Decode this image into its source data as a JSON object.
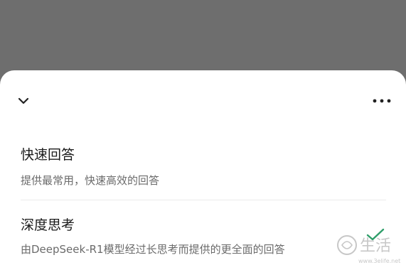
{
  "sheet": {
    "collapse_icon": "chevron-down-icon",
    "more_icon": "more-horizontal-icon"
  },
  "options": [
    {
      "title": "快速回答",
      "description": "提供最常用，快速高效的回答",
      "selected": false
    },
    {
      "title": "深度思考",
      "description": "由DeepSeek-R1模型经过长思考而提供的更全面的回答",
      "selected": true
    }
  ],
  "watermark": {
    "brand": "生活",
    "url": "www.3elife.net"
  },
  "colors": {
    "backdrop": "#6e6e6e",
    "sheet": "#ffffff",
    "title": "#1a1a1a",
    "description": "#6b6b6b",
    "check": "#2f9e6a"
  }
}
